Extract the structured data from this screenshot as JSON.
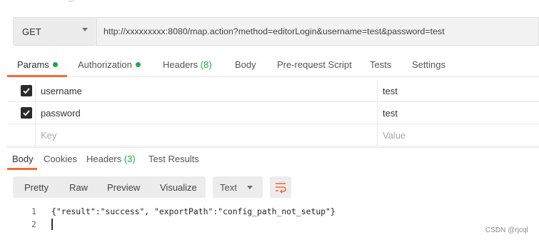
{
  "request": {
    "method": "GET",
    "url": "http://xxxxxxxxx:8080/map.action?method=editorLogin&username=test&password=test"
  },
  "request_tabs": [
    {
      "label": "Params",
      "dot": true,
      "active": true
    },
    {
      "label": "Authorization",
      "dot": true
    },
    {
      "label": "Headers",
      "count": "(8)"
    },
    {
      "label": "Body"
    },
    {
      "label": "Pre-request Script"
    },
    {
      "label": "Tests"
    },
    {
      "label": "Settings"
    }
  ],
  "params": [
    {
      "key": "username",
      "value": "test",
      "checked": true
    },
    {
      "key": "password",
      "value": "test",
      "checked": true
    }
  ],
  "params_placeholder": {
    "key": "Key",
    "value": "Value"
  },
  "response_tabs": [
    {
      "label": "Body",
      "active": true
    },
    {
      "label": "Cookies"
    },
    {
      "label": "Headers",
      "count": "(3)"
    },
    {
      "label": "Test Results"
    }
  ],
  "view_modes": [
    "Pretty",
    "Raw",
    "Preview",
    "Visualize"
  ],
  "format_select": "Text",
  "response_lines": [
    {
      "num": "1",
      "text": "{\"result\":\"success\", \"exportPath\":\"config_path_not_setup\"}"
    },
    {
      "num": "2",
      "text": ""
    }
  ],
  "watermark": "CSDN @rjcql",
  "colors": {
    "accent": "#f26b3a",
    "dot": "#1ea84a",
    "count": "#1ea84a"
  }
}
